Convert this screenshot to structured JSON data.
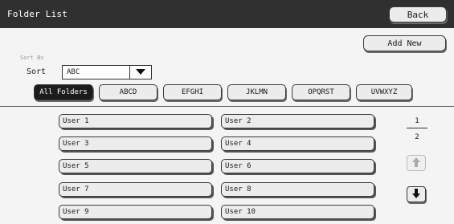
{
  "header": {
    "title": "Folder List",
    "back_label": "Back"
  },
  "actions": {
    "add_new_label": "Add New"
  },
  "sort": {
    "faint_text": "Sort By Name",
    "label": "Sort",
    "value": "ABC"
  },
  "tabs": [
    {
      "label": "All Folders",
      "active": true
    },
    {
      "label": "ABCD",
      "active": false
    },
    {
      "label": "EFGHI",
      "active": false
    },
    {
      "label": "JKLMN",
      "active": false
    },
    {
      "label": "OPQRST",
      "active": false
    },
    {
      "label": "UVWXYZ",
      "active": false
    }
  ],
  "users": [
    {
      "label": "User 1"
    },
    {
      "label": "User 2"
    },
    {
      "label": "User 3"
    },
    {
      "label": "User 4"
    },
    {
      "label": "User 5"
    },
    {
      "label": "User 6"
    },
    {
      "label": "User 7"
    },
    {
      "label": "User 8"
    },
    {
      "label": "User 9"
    },
    {
      "label": "User 10"
    }
  ],
  "pager": {
    "current": "1",
    "total": "2"
  },
  "icons": {
    "dropdown": "dropdown-arrow-icon",
    "page_up": "up-arrow-icon",
    "page_down": "down-arrow-icon"
  }
}
